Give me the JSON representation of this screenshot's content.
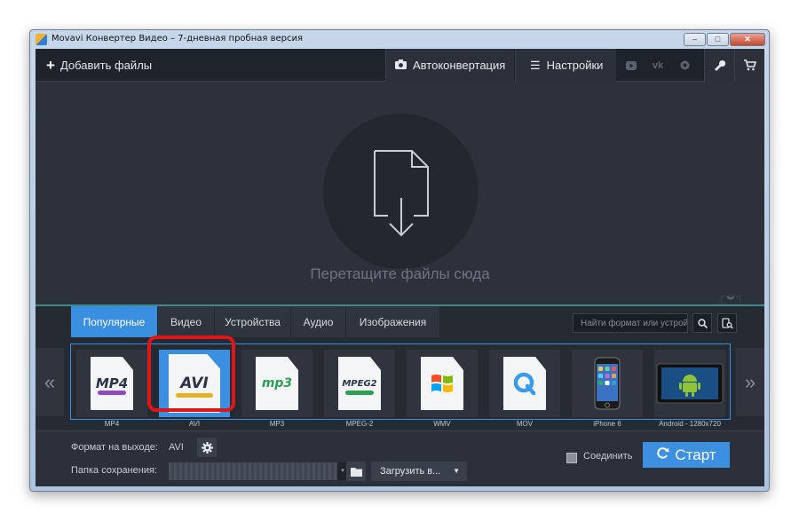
{
  "window": {
    "title": "Movavi Конвертер Видео – 7-дневная пробная версия",
    "minimize": "–",
    "maximize": "□",
    "close": "✕"
  },
  "toolbar": {
    "add_files_label": "Добавить файлы",
    "autoconvert_label": "Автоконвертация",
    "settings_label": "Настройки",
    "social": [
      "youtube-icon",
      "vk-icon",
      "facebook-icon"
    ]
  },
  "drop_area": {
    "hint": "Перетащите файлы сюда"
  },
  "format_panel": {
    "tabs": [
      {
        "label": "Популярные",
        "active": true
      },
      {
        "label": "Видео",
        "active": false
      },
      {
        "label": "Устройства",
        "active": false
      },
      {
        "label": "Аудио",
        "active": false
      },
      {
        "label": "Изображения",
        "active": false
      }
    ],
    "search_placeholder": "Найти формат или устрой...",
    "formats": [
      {
        "label": "MP4",
        "badge": "MP4",
        "accent": "#8e4bbf"
      },
      {
        "label": "AVI",
        "badge": "AVI",
        "accent": "#e6b224",
        "selected": true
      },
      {
        "label": "MP3",
        "badge": "mp3",
        "accent": "#2e9e55"
      },
      {
        "label": "MPEG-2",
        "badge": "MPEG2",
        "accent": "#2e9e55"
      },
      {
        "label": "WMV",
        "badge": "windows-logo-icon",
        "accent": "#f25022"
      },
      {
        "label": "MOV",
        "badge": "quicktime-icon",
        "accent": "#3a9be8"
      },
      {
        "label": "iPhone 6",
        "badge": "iphone-icon",
        "accent": "#1c1c1c"
      },
      {
        "label": "Android - 1280x720",
        "badge": "android-tablet-icon",
        "accent": "#8fc33a"
      }
    ],
    "prev_arrow": "«",
    "next_arrow": "»"
  },
  "bottom": {
    "output_format_label": "Формат на выходе:",
    "output_format_value": "AVI",
    "save_folder_label": "Папка сохранения:",
    "upload_label": "Загрузить в...",
    "join_label": "Соединить",
    "start_label": "Старт"
  },
  "colors": {
    "accent": "#3a8fe0",
    "highlight": "#e01616",
    "background": "#2b303b"
  }
}
